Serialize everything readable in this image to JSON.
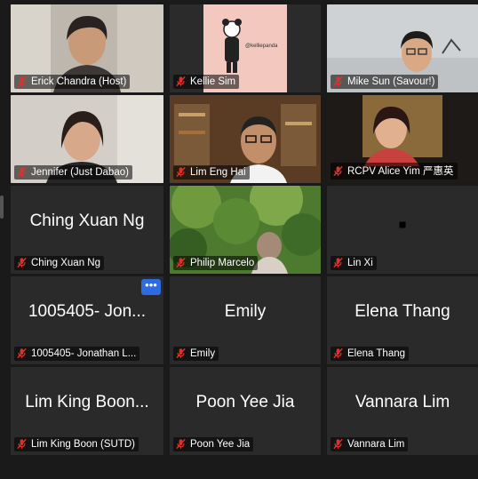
{
  "tiles": [
    {
      "label": "Erick Chandra (Host)",
      "display": "",
      "video": "erick",
      "active": false
    },
    {
      "label": "Kellie Sim",
      "display": "",
      "video": "kellie",
      "active": false,
      "video_text": "@kelliepanda"
    },
    {
      "label": "Mike Sun (Savour!)",
      "display": "",
      "video": "mike",
      "active": true
    },
    {
      "label": "Jennifer (Just Dabao)",
      "display": "",
      "video": "jennifer",
      "active": false
    },
    {
      "label": "Lim Eng Hai",
      "display": "",
      "video": "lim",
      "active": false
    },
    {
      "label": "RCPV Alice Yim 严惠英",
      "display": "",
      "video": "alice",
      "active": false
    },
    {
      "label": "Ching Xuan Ng",
      "display": "Ching Xuan Ng",
      "video": "",
      "active": false
    },
    {
      "label": "Philip Marcelo",
      "display": "",
      "video": "philip",
      "active": false
    },
    {
      "label": "Lin Xi",
      "display": "",
      "video": "dark",
      "active": false
    },
    {
      "label": "1005405- Jonathan L...",
      "display": "1005405- Jon...",
      "video": "",
      "active": false,
      "more": "•••"
    },
    {
      "label": "Emily",
      "display": "Emily",
      "video": "",
      "active": false
    },
    {
      "label": "Elena Thang",
      "display": "Elena Thang",
      "video": "",
      "active": false
    },
    {
      "label": "Lim King Boon (SUTD)",
      "display": "Lim King Boon...",
      "video": "",
      "active": false
    },
    {
      "label": "Poon Yee Jia",
      "display": "Poon Yee Jia",
      "video": "",
      "active": false
    },
    {
      "label": "Vannara Lim",
      "display": "Vannara Lim",
      "video": "",
      "active": false
    }
  ],
  "colors": {
    "muted_mic": "#e0302a",
    "active_border": "#9ccc53",
    "more_button": "#2f6be0"
  },
  "icons": {
    "mic": "microphone-muted-icon",
    "more": "more-options-icon"
  }
}
